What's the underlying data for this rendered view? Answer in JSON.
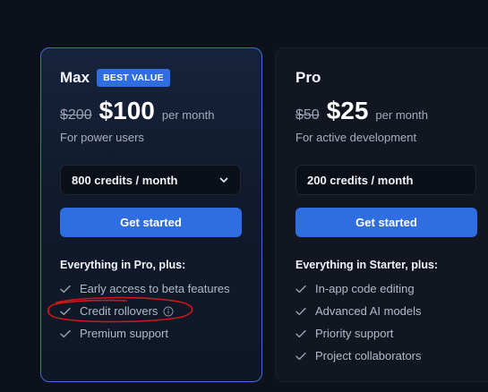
{
  "plans": {
    "max": {
      "name": "Max",
      "badge": "BEST VALUE",
      "old_price": "$200",
      "price": "$100",
      "period": "per month",
      "tagline": "For power users",
      "credits_select": "800 credits / month",
      "cta": "Get started",
      "section_title": "Everything in Pro, plus:",
      "features": [
        "Early access to beta features",
        "Credit rollovers",
        "Premium support"
      ]
    },
    "pro": {
      "name": "Pro",
      "old_price": "$50",
      "price": "$25",
      "period": "per month",
      "tagline": "For active development",
      "credits_select": "200 credits / month",
      "cta": "Get started",
      "section_title": "Everything in Starter, plus:",
      "features": [
        "In-app code editing",
        "Advanced AI models",
        "Priority support",
        "Project collaborators"
      ]
    }
  },
  "icons": {
    "check": "check-icon",
    "chevron": "chevron-down-icon",
    "info": "info-icon"
  },
  "colors": {
    "background": "#0d111b",
    "accent": "#2f6ee0",
    "highlight_border": "#3b6fd4",
    "annotation": "#d01818"
  }
}
